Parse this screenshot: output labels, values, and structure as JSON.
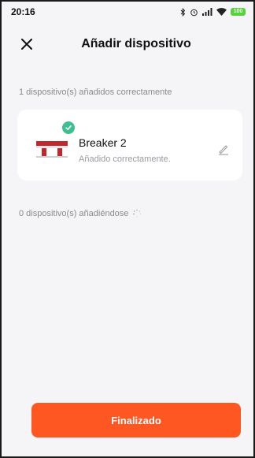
{
  "status_bar": {
    "time": "20:16",
    "icons": [
      "bluetooth-icon",
      "alarm-icon",
      "signal-icon",
      "wifi-icon",
      "battery-icon"
    ],
    "battery_label": "100"
  },
  "header": {
    "title": "Añadir dispositivo",
    "close_icon": "close-icon"
  },
  "added_section": {
    "label": "1 dispositivo(s) añadidos correctamente",
    "devices": [
      {
        "name": "Breaker 2",
        "status": "Añadido correctamente.",
        "badge_icon": "check-circle-icon",
        "edit_icon": "pencil-icon"
      }
    ]
  },
  "adding_section": {
    "label": "0 dispositivo(s) añadiéndose",
    "icon": "loading-spinner-icon"
  },
  "footer": {
    "finish_label": "Finalizado"
  },
  "colors": {
    "accent": "#ff5722",
    "success": "#3dbf92",
    "background": "#f5f5f7",
    "card": "#ffffff",
    "muted_text": "#8a8a8e"
  }
}
